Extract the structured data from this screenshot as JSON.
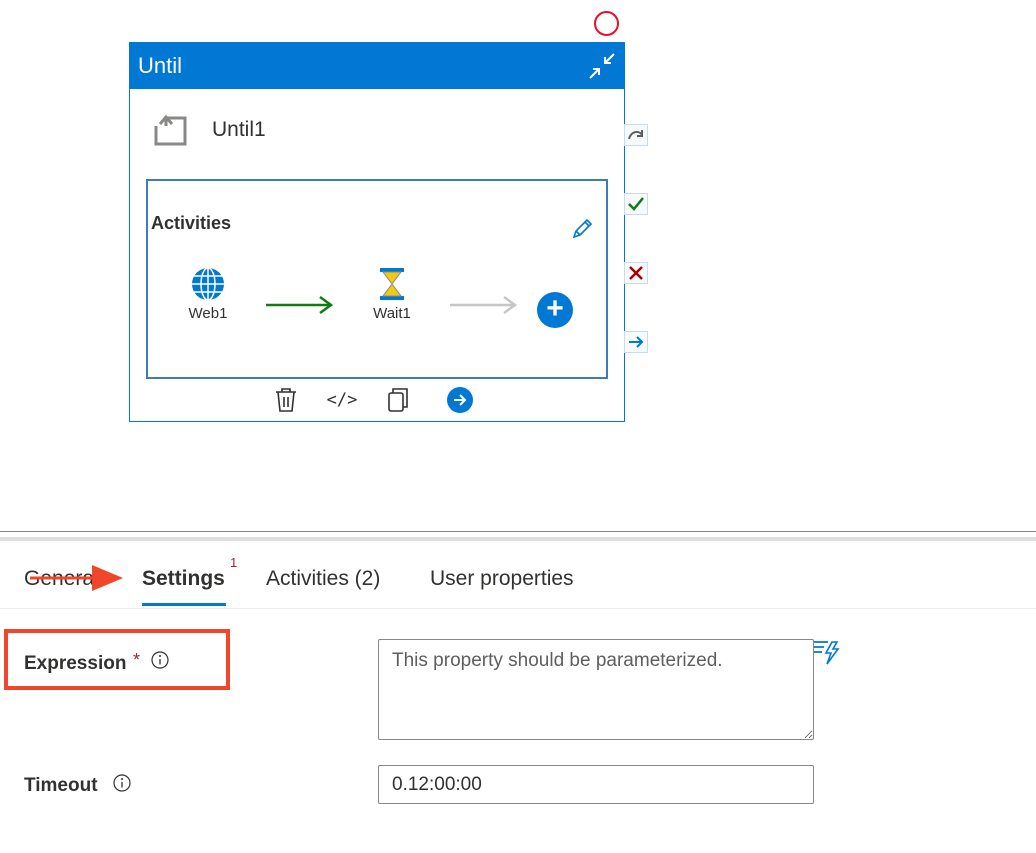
{
  "until_card": {
    "header_title": "Until",
    "activity_name": "Until1",
    "activities_label": "Activities",
    "activities": [
      {
        "name": "Web1",
        "icon": "globe-icon"
      },
      {
        "name": "Wait1",
        "icon": "hourglass-icon"
      }
    ],
    "toolbar": [
      "delete-icon",
      "code-icon",
      "copy-icon",
      "go-icon"
    ],
    "toolbar_code_glyph": "</>",
    "side_ports": [
      "skip-port-icon",
      "success-port-icon",
      "failure-port-icon",
      "completion-port-icon"
    ]
  },
  "tabs": [
    {
      "label": "General"
    },
    {
      "label": "Settings",
      "selected": true,
      "badge": "1"
    },
    {
      "label": "Activities (2)"
    },
    {
      "label": "User properties"
    }
  ],
  "settings": {
    "expression": {
      "label": "Expression",
      "required_mark": "*",
      "value": "",
      "placeholder": "This property should be parameterized."
    },
    "timeout": {
      "label": "Timeout",
      "value": "0.12:00:00"
    }
  },
  "colors": {
    "accent": "#0078d4",
    "annotation_red": "#f0462a",
    "required_red": "#a4262c",
    "success_arrow": "#107c10"
  }
}
